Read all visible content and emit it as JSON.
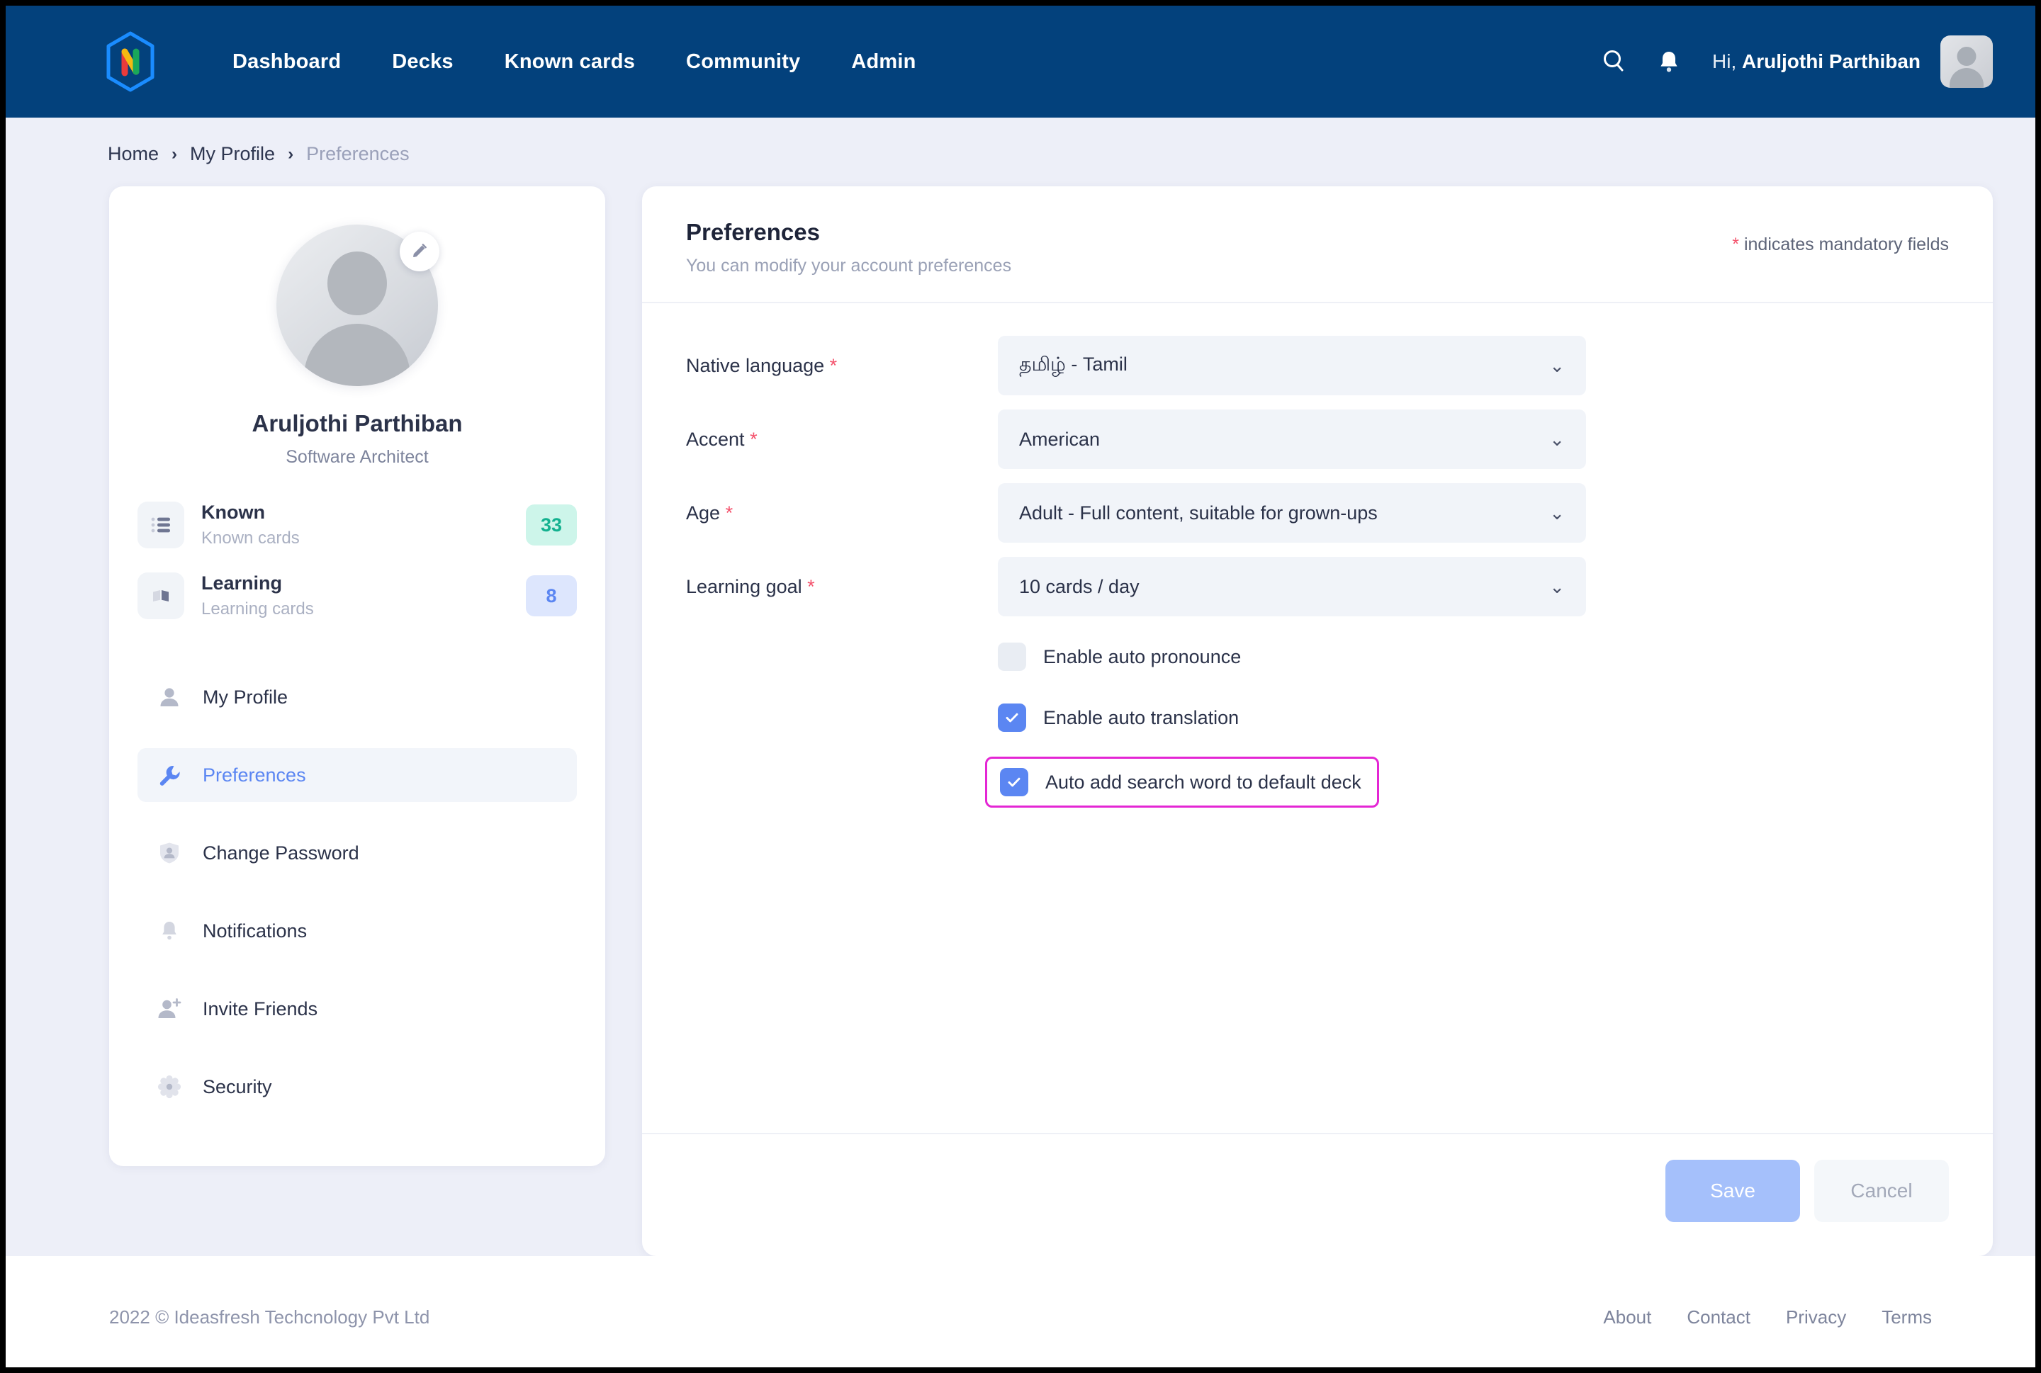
{
  "colors": {
    "header_bg": "#03417c",
    "page_bg": "#edeff8",
    "accent_blue": "#5b86f2",
    "required_red": "#f4526c",
    "highlight_magenta": "#e426d4",
    "badge_known_bg": "#cdf5ea",
    "badge_known_text": "#13b18f",
    "badge_learning_bg": "#dde6fd",
    "badge_learning_text": "#5b86f2",
    "save_button_bg": "#a5c0fb"
  },
  "header": {
    "logo_letter": "N",
    "nav": [
      {
        "label": "Dashboard"
      },
      {
        "label": "Decks"
      },
      {
        "label": "Known cards"
      },
      {
        "label": "Community"
      },
      {
        "label": "Admin"
      }
    ],
    "search_icon": "search-icon",
    "bell_icon": "bell-icon",
    "greeting_prefix": "Hi, ",
    "greeting_name": "Aruljothi Parthiban"
  },
  "breadcrumb": {
    "items": [
      {
        "label": "Home",
        "current": false
      },
      {
        "label": "My Profile",
        "current": false
      },
      {
        "label": "Preferences",
        "current": true
      }
    ],
    "separator": "›"
  },
  "profile": {
    "name": "Aruljothi Parthiban",
    "role": "Software Architect",
    "edit_icon": "pencil-icon",
    "stats": [
      {
        "title": "Known",
        "subtitle": "Known cards",
        "value": "33",
        "icon": "list-icon"
      },
      {
        "title": "Learning",
        "subtitle": "Learning cards",
        "value": "8",
        "icon": "book-icon"
      }
    ],
    "nav": [
      {
        "label": "My Profile",
        "icon": "person-icon",
        "active": false
      },
      {
        "label": "Preferences",
        "icon": "wrench-icon",
        "active": true
      },
      {
        "label": "Change Password",
        "icon": "shield-person-icon",
        "active": false
      },
      {
        "label": "Notifications",
        "icon": "bell-icon",
        "active": false
      },
      {
        "label": "Invite Friends",
        "icon": "person-add-icon",
        "active": false
      },
      {
        "label": "Security",
        "icon": "gear-icon",
        "active": false
      }
    ]
  },
  "panel": {
    "title": "Preferences",
    "subtitle": "You can modify your account preferences",
    "mandatory_note": "indicates mandatory fields",
    "mandatory_star": "*",
    "fields": [
      {
        "label": "Native language",
        "required": true,
        "value": "தமிழ் - Tamil"
      },
      {
        "label": "Accent",
        "required": true,
        "value": "American"
      },
      {
        "label": "Age",
        "required": true,
        "value": "Adult - Full content, suitable for grown-ups"
      },
      {
        "label": "Learning goal",
        "required": true,
        "value": "10 cards / day"
      }
    ],
    "caret_icon": "chevron-down-icon",
    "checkboxes": [
      {
        "label": "Enable auto pronounce",
        "checked": false,
        "highlighted": false
      },
      {
        "label": "Enable auto translation",
        "checked": true,
        "highlighted": false
      },
      {
        "label": "Auto add search word to default deck",
        "checked": true,
        "highlighted": true
      }
    ],
    "save_label": "Save",
    "cancel_label": "Cancel"
  },
  "footer": {
    "copyright": "2022 © Ideasfresh Techcnology Pvt Ltd",
    "links": [
      {
        "label": "About"
      },
      {
        "label": "Contact"
      },
      {
        "label": "Privacy"
      },
      {
        "label": "Terms"
      }
    ]
  }
}
